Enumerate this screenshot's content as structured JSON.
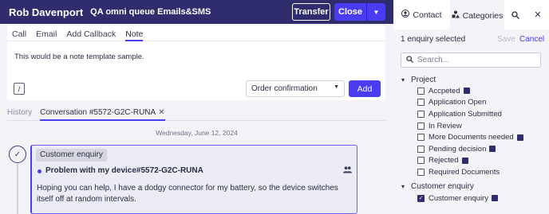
{
  "header": {
    "agent_name": "Rob Davenport",
    "queue_name": "QA omni queue Emails&SMS",
    "transfer_label": "Transfer",
    "close_label": "Close"
  },
  "composer": {
    "tabs": [
      {
        "label": "Call",
        "active": false
      },
      {
        "label": "Email",
        "active": false
      },
      {
        "label": "Add Callback",
        "active": false
      },
      {
        "label": "Note",
        "active": true
      }
    ],
    "note_text": "This would be a note template sample.",
    "slash_label": "/",
    "template_selected": "Order confirmation",
    "add_label": "Add"
  },
  "history": {
    "tabs": [
      {
        "label": "History",
        "active": false
      },
      {
        "label": "Conversation #5572-G2C-RUNA",
        "active": true
      }
    ],
    "close_glyph": "✕",
    "date": "Wednesday, June 12, 2024"
  },
  "card": {
    "badge": "Customer enquiry",
    "title": "Problem with my device#5572-G2C-RUNA",
    "body": "Hoping you can help, I have a dodgy connector for my battery, so the device switches itself off at random intervals."
  },
  "right_panel": {
    "tabs": [
      {
        "label": "Contact",
        "icon": "person-icon"
      },
      {
        "label": "Categories",
        "icon": "categories-icon"
      }
    ],
    "enquiry_count_label": "1 enquiry selected",
    "save_label": "Save",
    "cancel_label": "Cancel",
    "search_placeholder": "Search...",
    "groups": [
      {
        "name": "Project",
        "items": [
          {
            "label": "Accpeted",
            "checked": false,
            "has_note": true
          },
          {
            "label": "Application Open",
            "checked": false,
            "has_note": false
          },
          {
            "label": "Application Submitted",
            "checked": false,
            "has_note": false
          },
          {
            "label": "In Review",
            "checked": false,
            "has_note": false
          },
          {
            "label": "More Documents needed",
            "checked": false,
            "has_note": true
          },
          {
            "label": "Pending decision",
            "checked": false,
            "has_note": true
          },
          {
            "label": "Rejected",
            "checked": false,
            "has_note": true
          },
          {
            "label": "Required Documents",
            "checked": false,
            "has_note": false
          }
        ]
      },
      {
        "name": "Customer enquiry",
        "items": [
          {
            "label": "Customer enquiry",
            "checked": true,
            "has_note": true
          }
        ]
      }
    ]
  },
  "colors": {
    "header_bg": "#2f2d6e",
    "accent": "#4a3cf0"
  }
}
